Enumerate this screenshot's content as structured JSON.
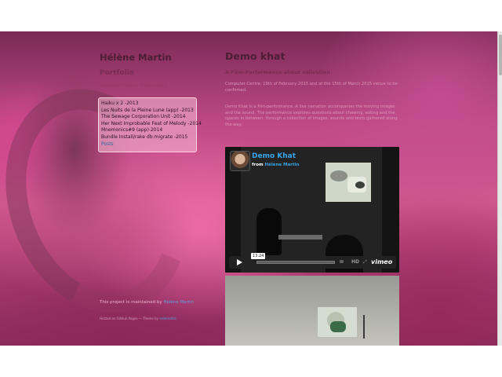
{
  "sidebar": {
    "site_title": "Hélène Martin",
    "section_title": "Portfolio",
    "section_link": "Researchers Interests",
    "projects": [
      "Haiku x 2 -2013",
      "Les Nuits de la Pleine Lune (app) -2013",
      "The Sewage Corporation Unit -2014",
      "Her Next Improbable Feat of Melody -2014",
      "Mnemonics#9 (app)-2014",
      "Bundle Install/rake db:migrate -2015"
    ],
    "projects_more": "Posts",
    "footer_maintained_prefix": "This project is maintained by",
    "footer_maintained_author": "Hélène Martin",
    "footer_hosted_prefix": "Hosted on GitHub Pages — Theme by",
    "footer_hosted_theme": "orderedlist"
  },
  "main": {
    "title": "Demo khat",
    "subtitle": "A Film-Performance about salivation",
    "paragraph1": "Computer Centre, 19th of February 2015 and at the 15th of March 2015 venue to be confirmed.",
    "paragraph2": "Demo Khat is a film-performance. A live narration accompanies the moving images and the sound. The performance explores questions about chewing, eating and the spaces in between, through a collection of images, sounds and texts gathered along the way."
  },
  "video": {
    "title": "Demo Khat",
    "by_prefix": "from",
    "by_author": "Hélène Martin",
    "duration": "13:24",
    "hd_label": "HD",
    "volume_glyph": "IIIII",
    "fullscreen_glyph": "⤢",
    "player_logo": "vimeo",
    "play_icon": "play-icon",
    "accent_color": "#38a5e8"
  }
}
